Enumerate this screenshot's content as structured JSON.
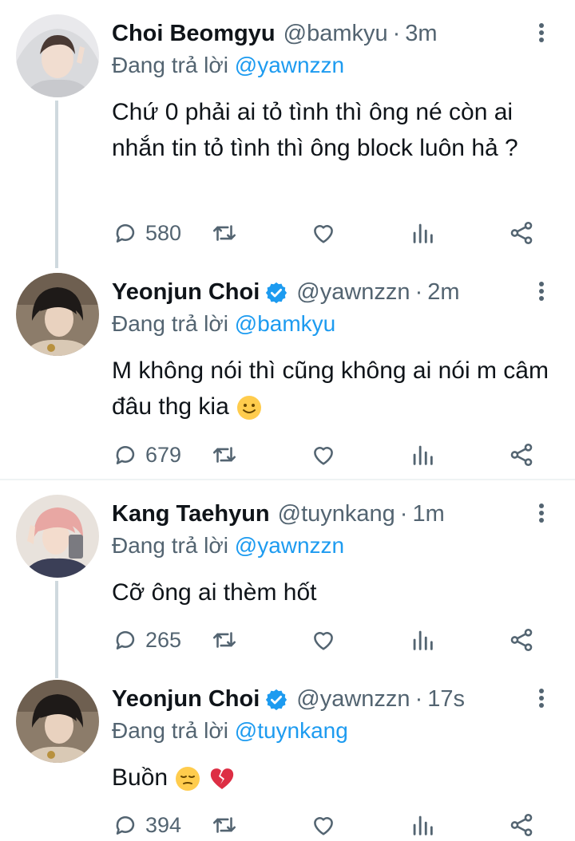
{
  "tweets": [
    {
      "name": "Choi Beomgyu",
      "handle": "@bamkyu",
      "time": "3m",
      "replying_prefix": "Đang trả lời",
      "replying_to": "@yawnzzn",
      "text": "Chứ 0 phải ai tỏ tình thì ông né còn ai nhắn tin tỏ tình thì ông block luôn hả ?",
      "reply_count": "580",
      "verified": false
    },
    {
      "name": "Yeonjun Choi",
      "handle": "@yawnzzn",
      "time": "2m",
      "replying_prefix": "Đang trả lời",
      "replying_to": "@bamkyu",
      "text": "M không nói thì cũng không ai nói m câm đâu thg kia",
      "text_emoji": "slightly-smiling-face",
      "reply_count": "679",
      "verified": true
    },
    {
      "name": "Kang Taehyun",
      "handle": "@tuynkang",
      "time": "1m",
      "replying_prefix": "Đang trả lời",
      "replying_to": "@yawnzzn",
      "text": "Cỡ ông ai thèm hốt",
      "reply_count": "265",
      "verified": false
    },
    {
      "name": "Yeonjun Choi",
      "handle": "@yawnzzn",
      "time": "17s",
      "replying_prefix": "Đang trả lời",
      "replying_to": "@tuynkang",
      "text": "Buồn",
      "text_emoji": [
        "pensive-face",
        "broken-heart"
      ],
      "reply_count": "394",
      "verified": true
    }
  ],
  "icons": {
    "reply": "reply-icon",
    "retweet": "retweet-icon",
    "like": "heart-icon",
    "analytics": "analytics-icon",
    "share": "share-icon",
    "more": "more-options-icon"
  },
  "colors": {
    "link": "#1d9bf0",
    "secondary_text": "#536471",
    "verified": "#1d9bf0"
  }
}
